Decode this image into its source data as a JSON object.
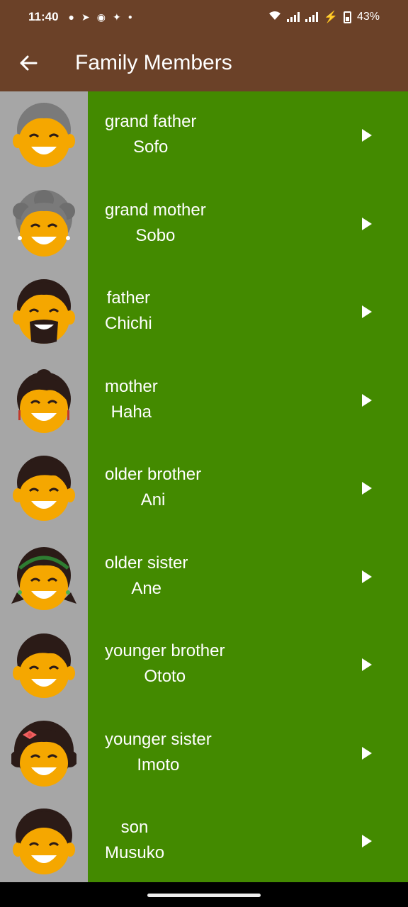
{
  "status_bar": {
    "time": "11:40",
    "left_icons": [
      "chat-icon",
      "telegram-icon",
      "discord-icon",
      "gamepad-icon",
      "dot-icon"
    ],
    "battery": "43%"
  },
  "app_bar": {
    "title": "Family Members",
    "back_icon": "arrow-left-icon"
  },
  "colors": {
    "app_bar": "#6b4128",
    "list_bg": "#438a00",
    "avatar_bg": "#a6a6a6",
    "face": "#f5a700",
    "hair_dark": "#2b1b17",
    "hair_grey": "#7a7a7a"
  },
  "members": [
    {
      "label": "grand father",
      "word": "Sofo",
      "avatar": "grandfather-avatar-icon"
    },
    {
      "label": "grand mother",
      "word": "Sobo",
      "avatar": "grandmother-avatar-icon"
    },
    {
      "label": "father",
      "word": "Chichi",
      "avatar": "father-avatar-icon"
    },
    {
      "label": "mother",
      "word": "Haha",
      "avatar": "mother-avatar-icon"
    },
    {
      "label": "older brother",
      "word": "Ani",
      "avatar": "older-brother-avatar-icon"
    },
    {
      "label": "older sister",
      "word": "Ane",
      "avatar": "older-sister-avatar-icon"
    },
    {
      "label": "younger brother",
      "word": "Ototo",
      "avatar": "younger-brother-avatar-icon"
    },
    {
      "label": "younger sister",
      "word": "Imoto",
      "avatar": "younger-sister-avatar-icon"
    },
    {
      "label": "son",
      "word": "Musuko",
      "avatar": "son-avatar-icon"
    }
  ]
}
